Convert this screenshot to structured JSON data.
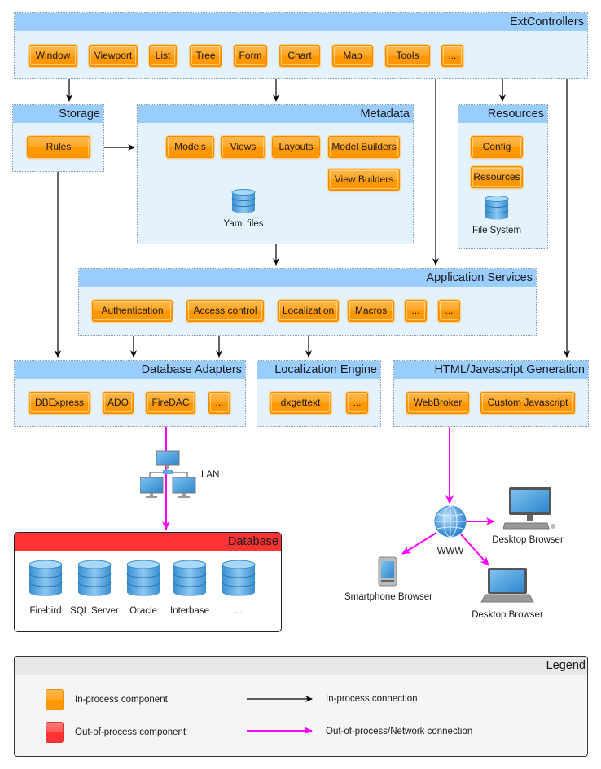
{
  "groups": {
    "ext_controllers": {
      "title": "ExtControllers",
      "items": [
        "Window",
        "Viewport",
        "List",
        "Tree",
        "Form",
        "Chart",
        "Map",
        "Tools",
        "..."
      ]
    },
    "storage": {
      "title": "Storage",
      "items": [
        "Rules"
      ]
    },
    "metadata": {
      "title": "Metadata",
      "items": [
        "Models",
        "Views",
        "Layouts",
        "Model Builders",
        "View Builders"
      ],
      "store_label": "Yaml files"
    },
    "resources": {
      "title": "Resources",
      "items": [
        "Config",
        "Resources"
      ],
      "store_label": "File System"
    },
    "application_services": {
      "title": "Application Services",
      "items": [
        "Authentication",
        "Access control",
        "Localization",
        "Macros",
        "...",
        "..."
      ]
    },
    "database_adapters": {
      "title": "Database Adapters",
      "items": [
        "DBExpress",
        "ADO",
        "FireDAC",
        "..."
      ]
    },
    "localization_engine": {
      "title": "Localization Engine",
      "items": [
        "dxgettext",
        "..."
      ]
    },
    "html_generation": {
      "title": "HTML/Javascript Generation",
      "items": [
        "WebBroker",
        "Custom Javascript"
      ]
    }
  },
  "network": {
    "lan_label": "LAN",
    "www_label": "WWW",
    "clients": [
      "Desktop Browser",
      "Smartphone Browser",
      "Desktop Browser"
    ]
  },
  "database": {
    "title": "Database",
    "engines": [
      "Firebird",
      "SQL Server",
      "Oracle",
      "Interbase",
      "..."
    ]
  },
  "legend": {
    "title": "Legend",
    "in_process_component": "In-process component",
    "out_of_process_component": "Out-of-process component",
    "in_process_connection": "In-process connection",
    "network_connection": "Out-of-process/Network connection"
  },
  "colors": {
    "group_header": "#99ccff",
    "group_body": "#e3f2fd",
    "component": "#ff9800",
    "database_header": "#ff3333",
    "in_process_line": "#000000",
    "network_line": "#ff00ff"
  }
}
